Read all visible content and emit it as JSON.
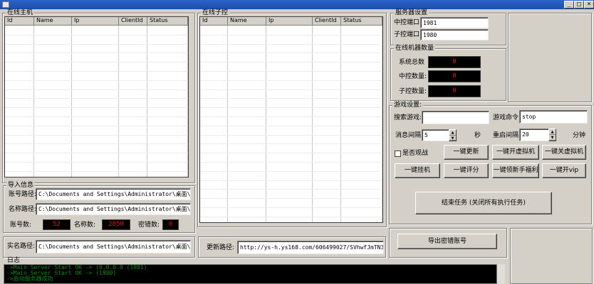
{
  "window": {
    "minimize": "_",
    "maximize": "□",
    "close": "×"
  },
  "online_hosts": {
    "title": "在线主机",
    "columns": [
      "Id",
      "Name",
      "Ip",
      "ClientId",
      "Status"
    ]
  },
  "online_children": {
    "title": "在线子控",
    "columns": [
      "Id",
      "Name",
      "Ip",
      "ClientId",
      "Status"
    ]
  },
  "server_settings": {
    "title": "服务器设置",
    "central_port_label": "中控端口:",
    "central_port_value": "1981",
    "child_port_label": "子控端口:",
    "child_port_value": "1980"
  },
  "machine_count": {
    "title": "在线机器数量",
    "total_label": "系统总数",
    "total_value": "0",
    "central_label": "中控数量:",
    "central_value": "0",
    "child_label": "子控数量:",
    "child_value": "0"
  },
  "game_settings": {
    "title": "游戏设置:",
    "search_game_label": "搜索游戏:",
    "search_game_value": "",
    "game_command_label": "游戏命令:",
    "game_command_value": "stop",
    "message_interval_label": "消息间隔:",
    "message_interval_value": "5",
    "message_interval_unit": "秒",
    "restart_interval_label": "重启间隔:",
    "restart_interval_value": "20",
    "restart_interval_unit": "分钟",
    "pk_checkbox_label": "是否观战",
    "buttons": {
      "update": "一键更新",
      "open_vm": "一键开虚拟机",
      "close_vm": "一键关虚拟机",
      "hangup": "一键挂机",
      "rate": "一键评分",
      "newbie_bonus": "一键领新手福利",
      "open_vip": "一键开vip"
    },
    "end_task": "结束任务 (关闭所有执行任务)"
  },
  "import_info": {
    "title": "导入信息",
    "account_path_label": "账号路径:",
    "account_path_value": "C:\\Documents and Settings\\Administrator\\桌面\\远控\\网易",
    "name_path_label": "名称路径:",
    "name_path_value": "C:\\Documents and Settings\\Administrator\\桌面\\远控\\角色",
    "account_count_label": "账号数:",
    "account_count_value": "52",
    "name_count_label": "名称数:",
    "name_count_value": "2850",
    "password_error_label": "密错数:",
    "password_error_value": "0"
  },
  "realname": {
    "label": "实名路径:",
    "value": "C:\\Documents and Settings\\Administrator\\桌面\\远控\\实名"
  },
  "update_path": {
    "label": "更新路径:",
    "value": "http://ys-h.ys168.com/606499027/SVhwfJmTN3T556G47PK"
  },
  "export_button": "导出密错账号",
  "log": {
    "title": "日志",
    "lines": [
      "->Main Server Start OK -> (0.0.0.0 (1981)",
      "->Main Server Start OK -> (1980)",
      "->启动服务器成功"
    ]
  },
  "colors": {
    "led_text": "#e01010",
    "log_text": "#0a8a0a",
    "titlebar": "#2a63c9"
  }
}
